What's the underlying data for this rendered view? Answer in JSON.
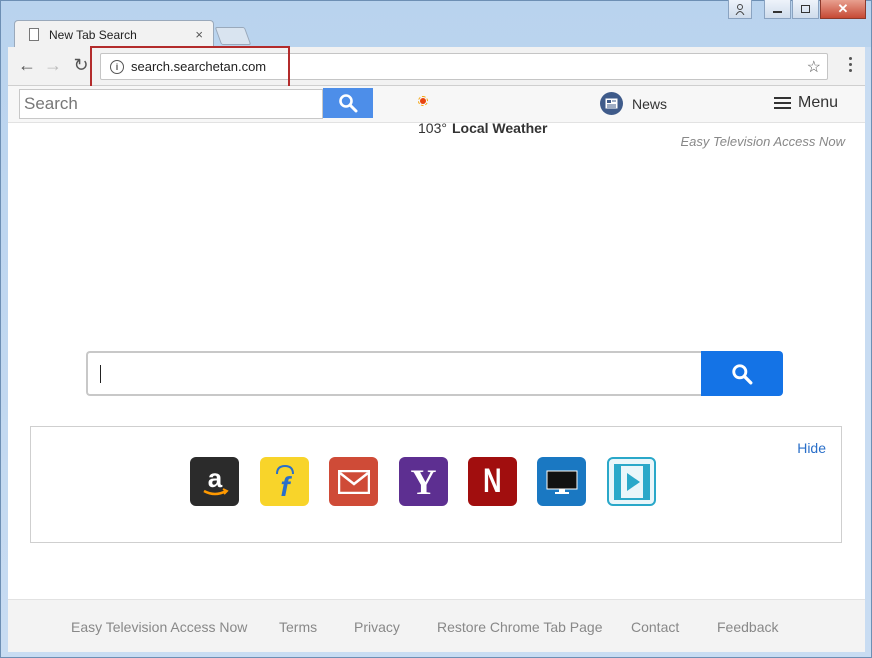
{
  "browser": {
    "tab_title": "New Tab Search",
    "tab_close": "×",
    "url": "search.searchetan.com",
    "colors": {
      "highlight_box": "#b32b2b",
      "frame": "#b9d3ee"
    }
  },
  "topbar": {
    "search_placeholder": "Search",
    "news_label": "News",
    "menu_label": "Menu",
    "weather_temp": "103°",
    "weather_label": "Local Weather",
    "tagline": "Easy Television Access Now"
  },
  "tiles": {
    "hide_label": "Hide",
    "items": [
      {
        "name": "amazon",
        "icon": "amazon-icon",
        "color": "#2b2b2b"
      },
      {
        "name": "flipkart",
        "icon": "flipkart-icon",
        "color": "#f8d42a"
      },
      {
        "name": "gmail",
        "icon": "mail-icon",
        "color": "#cf4b37"
      },
      {
        "name": "yahoo",
        "icon": "yahoo-icon",
        "color": "#5d2f91"
      },
      {
        "name": "netflix",
        "icon": "netflix-icon",
        "color": "#a10e0e"
      },
      {
        "name": "tv",
        "icon": "monitor-icon",
        "color": "#1a78c2"
      },
      {
        "name": "video",
        "icon": "video-play-icon",
        "color": "#2aa8c9"
      }
    ],
    "yahoo_glyph": "Y",
    "netflix_glyph": "N"
  },
  "footer": {
    "links": [
      "Easy Television Access Now",
      "Terms",
      "Privacy",
      "Restore Chrome Tab Page",
      "Contact",
      "Feedback"
    ]
  }
}
